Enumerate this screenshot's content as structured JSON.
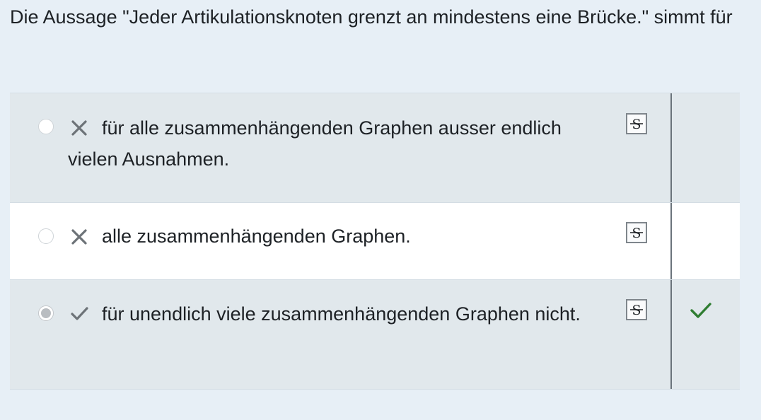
{
  "question": {
    "text": "Die Aussage \"Jeder Artikulationsknoten grenzt an mindestens eine Brücke.\" simmt für"
  },
  "answers": [
    {
      "text": "für alle zusammenhängenden Graphen ausser endlich vielen Ausnahmen.",
      "selected": false,
      "mark": "x-icon",
      "feedback": null
    },
    {
      "text": "alle zusammenhängenden Graphen.",
      "selected": false,
      "mark": "x-icon",
      "feedback": null
    },
    {
      "text": "für unendlich viele zusammenhängenden Graphen nicht.",
      "selected": true,
      "mark": "check-icon",
      "feedback": "correct-check-icon"
    }
  ],
  "strike_button": {
    "label": "S",
    "icon": "strikethrough-icon"
  },
  "colors": {
    "background": "#e7eff6",
    "row_shaded": "#e1e8ec",
    "row_white": "#ffffff",
    "correct_green": "#2f7d32",
    "mark_gray": "#6d7378"
  }
}
